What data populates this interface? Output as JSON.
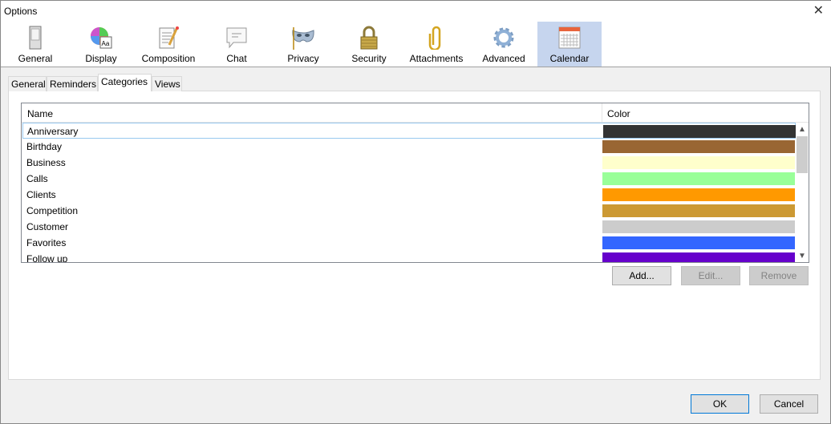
{
  "window": {
    "title": "Options",
    "close": "✕"
  },
  "toolbar": [
    {
      "label": "General",
      "icon": "switch-icon"
    },
    {
      "label": "Display",
      "icon": "color-wheel-icon"
    },
    {
      "label": "Composition",
      "icon": "notepad-pencil-icon"
    },
    {
      "label": "Chat",
      "icon": "chat-bubble-icon"
    },
    {
      "label": "Privacy",
      "icon": "mask-icon"
    },
    {
      "label": "Security",
      "icon": "padlock-icon"
    },
    {
      "label": "Attachments",
      "icon": "paperclip-icon"
    },
    {
      "label": "Advanced",
      "icon": "gear-icon"
    },
    {
      "label": "Calendar",
      "icon": "calendar-icon",
      "selected": true
    }
  ],
  "tabs": [
    {
      "label": "General"
    },
    {
      "label": "Reminders"
    },
    {
      "label": "Categories",
      "active": true
    },
    {
      "label": "Views"
    }
  ],
  "list": {
    "columns": [
      "Name",
      "Color"
    ],
    "rows": [
      {
        "name": "Anniversary",
        "color": "#333333"
      },
      {
        "name": "Birthday",
        "color": "#996633"
      },
      {
        "name": "Business",
        "color": "#ffffcc"
      },
      {
        "name": "Calls",
        "color": "#99ff99"
      },
      {
        "name": "Clients",
        "color": "#ff9900"
      },
      {
        "name": "Competition",
        "color": "#cc9933"
      },
      {
        "name": "Customer",
        "color": "#cccccc"
      },
      {
        "name": "Favorites",
        "color": "#3366ff"
      },
      {
        "name": "Follow up",
        "color": "#6600cc"
      }
    ]
  },
  "buttons": {
    "add": "Add...",
    "edit": "Edit...",
    "remove": "Remove",
    "ok": "OK",
    "cancel": "Cancel"
  }
}
